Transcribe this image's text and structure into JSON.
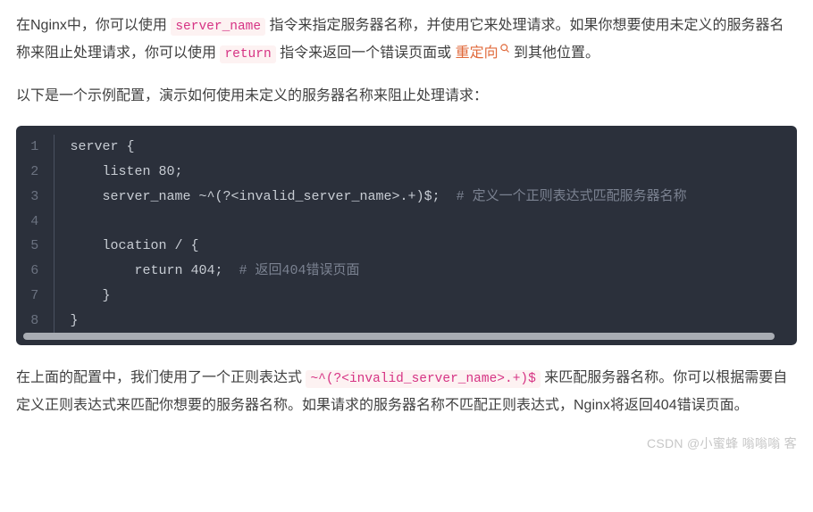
{
  "para1": {
    "seg1": "在Nginx中，你可以使用 ",
    "code1": "server_name",
    "seg2": " 指令来指定服务器名称，并使用它来处理请求。如果你想要使用未定义的服务器名称来阻止处理请求，你可以使用 ",
    "code2": "return",
    "seg3": " 指令来返回一个错误页面或 ",
    "link": "重定向",
    "seg4": " 到其他位置。"
  },
  "para2": "以下是一个示例配置，演示如何使用未定义的服务器名称来阻止处理请求：",
  "code_block": {
    "lines": [
      {
        "gutter": "1",
        "text": "server {",
        "comment": ""
      },
      {
        "gutter": "2",
        "text": "    listen 80;",
        "comment": ""
      },
      {
        "gutter": "3",
        "text": "    server_name ~^(?<invalid_server_name>.+)$;  ",
        "comment": "# 定义一个正则表达式匹配服务器名称"
      },
      {
        "gutter": "4",
        "text": "",
        "comment": ""
      },
      {
        "gutter": "5",
        "text": "    location / {",
        "comment": ""
      },
      {
        "gutter": "6",
        "text": "        return 404;  ",
        "comment": "# 返回404错误页面"
      },
      {
        "gutter": "7",
        "text": "    }",
        "comment": ""
      },
      {
        "gutter": "8",
        "text": "}",
        "comment": ""
      }
    ]
  },
  "para3": {
    "seg1": "在上面的配置中，我们使用了一个正则表达式 ",
    "code1": "~^(?<invalid_server_name>.+)$",
    "seg2": " 来匹配服务器名称。你可以根据需要自定义正则表达式来匹配你想要的服务器名称。如果请求的服务器名称不匹配正则表达式，Nginx将返回404错误页面。"
  },
  "watermark": "CSDN @小蜜蜂 嗡嗡嗡 客"
}
